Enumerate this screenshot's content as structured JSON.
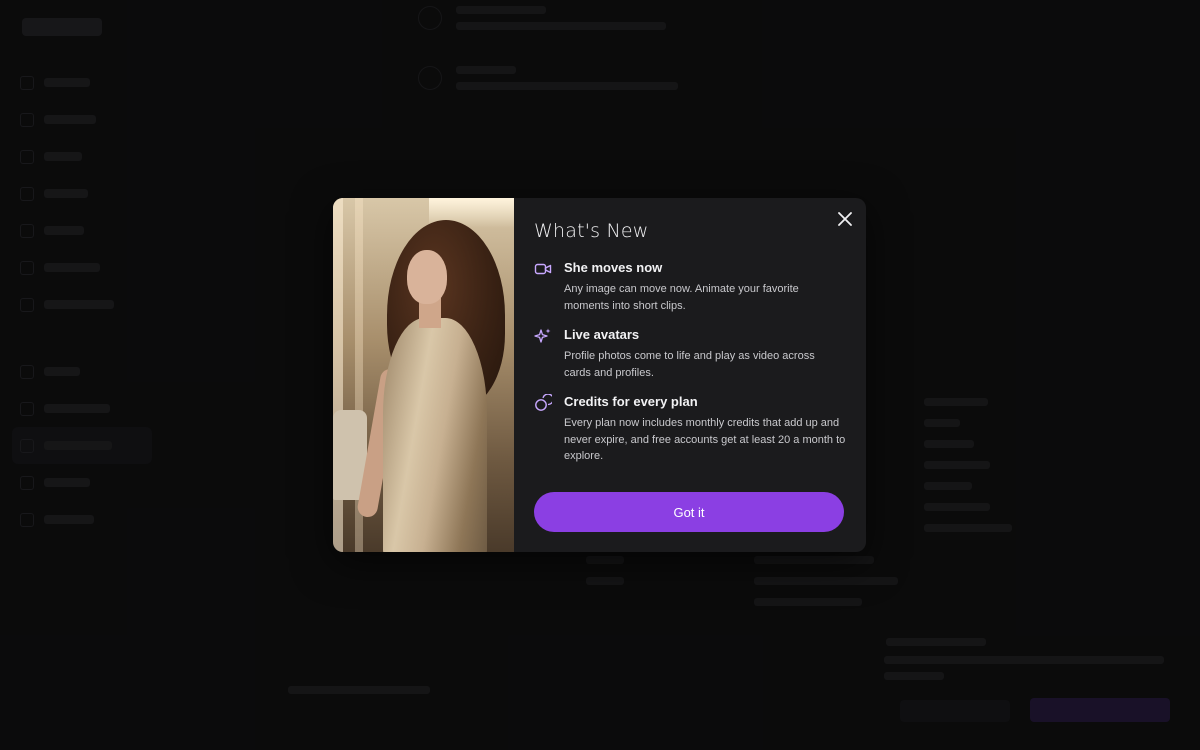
{
  "modal": {
    "title": "What's New",
    "close_icon": "close-icon",
    "image_alt": "woman-in-satin-dress",
    "features": [
      {
        "icon": "video-camera-icon",
        "title": "She moves now",
        "description": "Any image can move now. Animate your favorite moments into short clips."
      },
      {
        "icon": "sparkles-icon",
        "title": "Live avatars",
        "description": "Profile photos come to life and play as video across cards and profiles."
      },
      {
        "icon": "coins-icon",
        "title": "Credits for every plan",
        "description": "Every plan now includes monthly credits that add up and never expire, and free accounts get at least 20 a month to explore."
      }
    ],
    "cta_label": "Got it"
  },
  "colors": {
    "accent": "#8b3fe3",
    "icon_tint": "#c8a8ff",
    "modal_bg": "#1b1b1d",
    "backdrop": "#0d0d0e"
  }
}
